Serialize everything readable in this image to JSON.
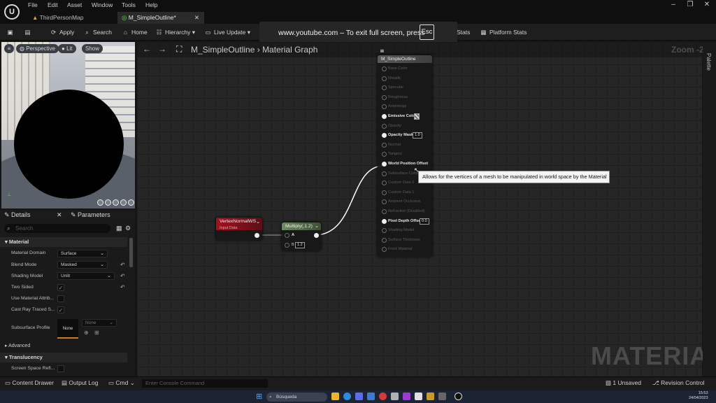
{
  "menu": [
    "File",
    "Edit",
    "Asset",
    "Window",
    "Tools",
    "Help"
  ],
  "tabs": [
    {
      "label": "ThirdPersonMap"
    },
    {
      "label": "M_SimpleOutline*"
    }
  ],
  "toolbar": {
    "apply": "Apply",
    "search": "Search",
    "home": "Home",
    "hierarchy": "Hierarchy",
    "live_update": "Live Update",
    "stats": "Stats",
    "platform_stats": "Platform Stats"
  },
  "fullscreen_notice": {
    "text": "www.youtube.com – To exit full screen, press",
    "key": "Esc"
  },
  "viewport": {
    "perspective": "Perspective",
    "lit": "Lit",
    "show": "Show"
  },
  "details": {
    "tab_details": "Details",
    "tab_parameters": "Parameters",
    "search_placeholder": "Search",
    "section_material": "Material",
    "material_domain_label": "Material Domain",
    "material_domain_value": "Surface",
    "blend_mode_label": "Blend Mode",
    "blend_mode_value": "Masked",
    "shading_model_label": "Shading Model",
    "shading_model_value": "Unlit",
    "two_sided_label": "Two Sided",
    "use_material_attrib_label": "Use Material Attrib...",
    "cast_ray_label": "Cast Ray Traced S...",
    "subsurface_profile_label": "Subsurface Profile",
    "subsurface_thumb": "None",
    "subsurface_combo": "None",
    "advanced": "Advanced",
    "section_translucency": "Translucency",
    "screen_space_refl_label": "Screen Space Refl..."
  },
  "graph": {
    "breadcrumb_asset": "M_SimpleOutline",
    "breadcrumb_graph": "Material Graph",
    "zoom": "Zoom -2",
    "watermark": "MATERIAL",
    "palette": "Palette"
  },
  "nodes": {
    "vertex": {
      "title": "VertexNormalWS",
      "subtitle": "Input Data"
    },
    "multiply": {
      "title": "Multiply(,1.2)",
      "pin_a": "A",
      "pin_b": "B",
      "b_value": "1.2"
    },
    "result": {
      "title": "M_SimpleOutline",
      "pins": [
        {
          "label": "Base Color",
          "on": false
        },
        {
          "label": "Metallic",
          "on": false
        },
        {
          "label": "Specular",
          "on": false
        },
        {
          "label": "Roughness",
          "on": false
        },
        {
          "label": "Anisotropy",
          "on": false
        },
        {
          "label": "Emissive Color",
          "on": true
        },
        {
          "label": "Opacity",
          "on": false
        },
        {
          "label": "Opacity Mask",
          "on": true,
          "value": "1.0"
        },
        {
          "label": "Normal",
          "on": false
        },
        {
          "label": "Tangent",
          "on": false
        },
        {
          "label": "World Position Offset",
          "on": true
        },
        {
          "label": "Subsurface Color",
          "on": false
        },
        {
          "label": "Custom Data 0",
          "on": false
        },
        {
          "label": "Custom Data 1",
          "on": false
        },
        {
          "label": "Ambient Occlusion",
          "on": false
        },
        {
          "label": "Refraction (Disabled)",
          "on": false
        },
        {
          "label": "Pixel Depth Offset",
          "on": true,
          "value": "0.0"
        },
        {
          "label": "Shading Model",
          "on": false
        },
        {
          "label": "Surface Thickness",
          "on": false
        },
        {
          "label": "Front Material",
          "on": false
        }
      ]
    },
    "tooltip": "Allows for the vertices of a mesh to be manipulated in world space by the Material"
  },
  "status": {
    "content_drawer": "Content Drawer",
    "output_log": "Output Log",
    "cmd": "Cmd",
    "console_placeholder": "Enter Console Command",
    "unsaved": "1 Unsaved",
    "revision_control": "Revision Control"
  },
  "taskbar": {
    "search": "Búsqueda",
    "time": "15:53",
    "date": "24/04/2023"
  }
}
